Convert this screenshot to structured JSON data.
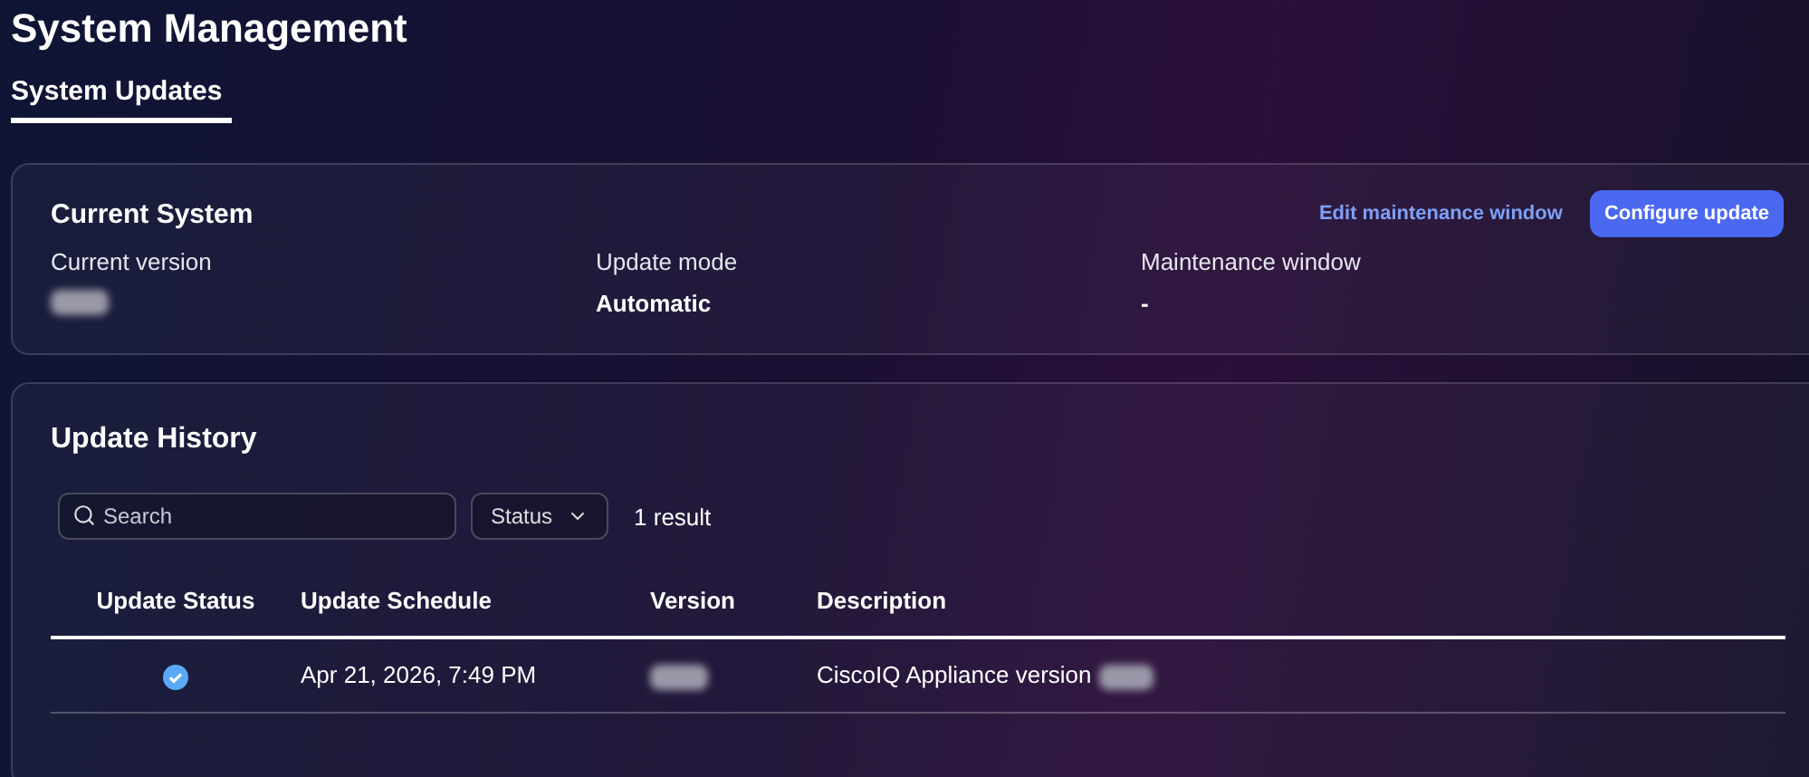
{
  "page_title": "System Management",
  "tabs": [
    {
      "label": "System Updates",
      "selected": true
    }
  ],
  "current_system": {
    "title": "Current System",
    "link": "Edit maintenance window",
    "button": "Configure update",
    "fields": [
      {
        "label": "Current version",
        "redacted": true
      },
      {
        "label": "Update mode",
        "value": "Automatic"
      },
      {
        "label": "Maintenance window",
        "value": "-"
      }
    ]
  },
  "update_history": {
    "title": "Update History",
    "search": {
      "placeholder": "Search"
    },
    "status_filter": "Status",
    "result_count": "1 result",
    "columns": [
      "Update Status",
      "Update Schedule",
      "Version",
      "Description"
    ],
    "rows": [
      {
        "succeeded": true,
        "schedule": "Apr 21, 2026, 7:49 PM",
        "version_redacted": true,
        "description": "CiscoIQ Appliance version",
        "description_redacted": true
      }
    ]
  }
}
